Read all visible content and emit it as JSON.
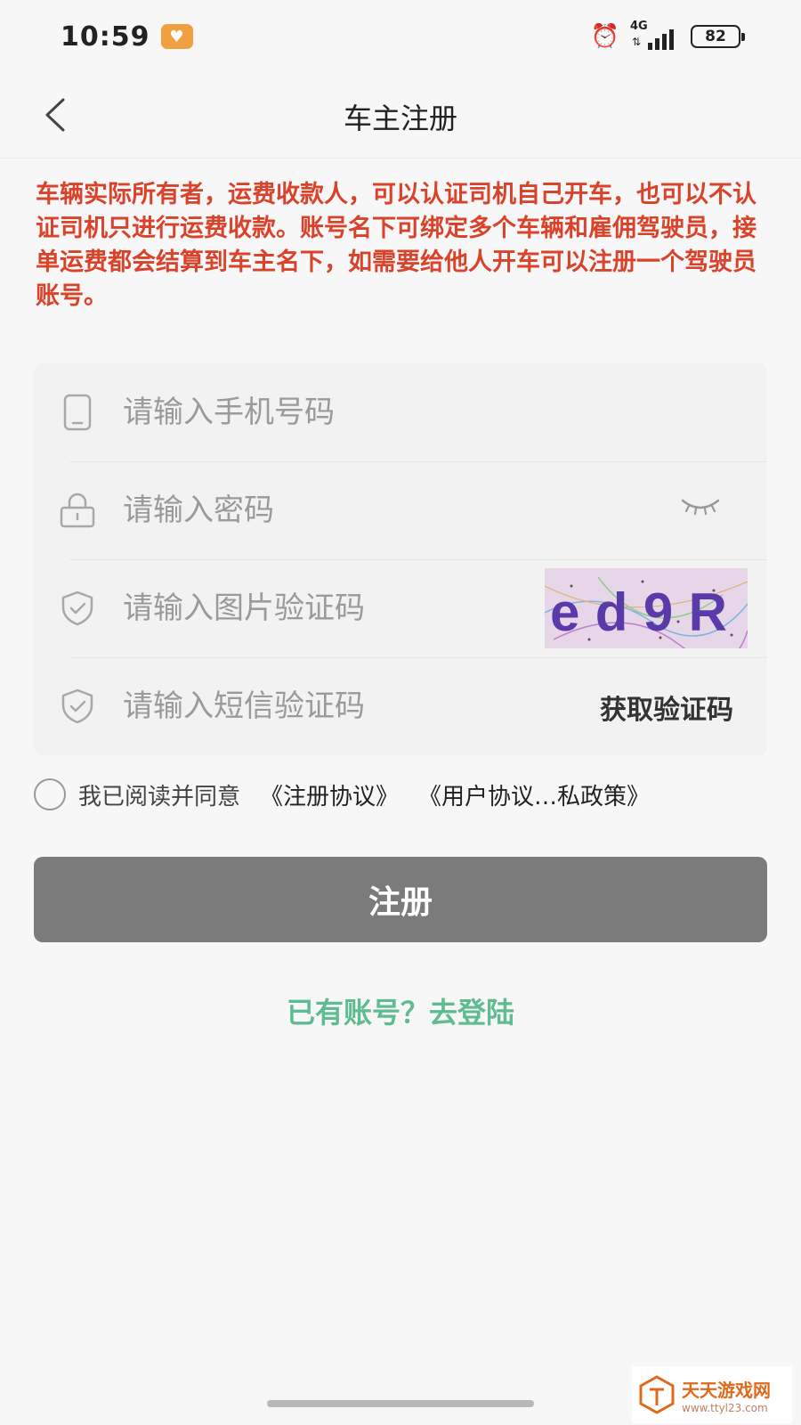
{
  "status": {
    "time": "10:59",
    "network": "4G",
    "battery": "82"
  },
  "header": {
    "title": "车主注册",
    "back_icon": "chevron-left-icon"
  },
  "notice": "车辆实际所有者，运费收款人，可以认证司机自己开车，也可以不认证司机只进行运费收款。账号名下可绑定多个车辆和雇佣驾驶员，接单运费都会结算到车主名下，如需要给他人开车可以注册一个驾驶员账号。",
  "form": {
    "phone_placeholder": "请输入手机号码",
    "password_placeholder": "请输入密码",
    "captcha_placeholder": "请输入图片验证码",
    "captcha_text": "ed9R",
    "sms_placeholder": "请输入短信验证码",
    "sms_button": "获取验证码"
  },
  "agreement": {
    "prefix": "我已阅读并同意",
    "link1": "《注册协议》",
    "link2": "《用户协议…私政策》"
  },
  "register_button": "注册",
  "login_link": "已有账号？去登陆",
  "watermark": {
    "name": "天天游戏网",
    "url": "www.ttyl23.com"
  },
  "colors": {
    "notice": "#d9432b",
    "button": "#7b7b7b",
    "link": "#5fbb90"
  }
}
